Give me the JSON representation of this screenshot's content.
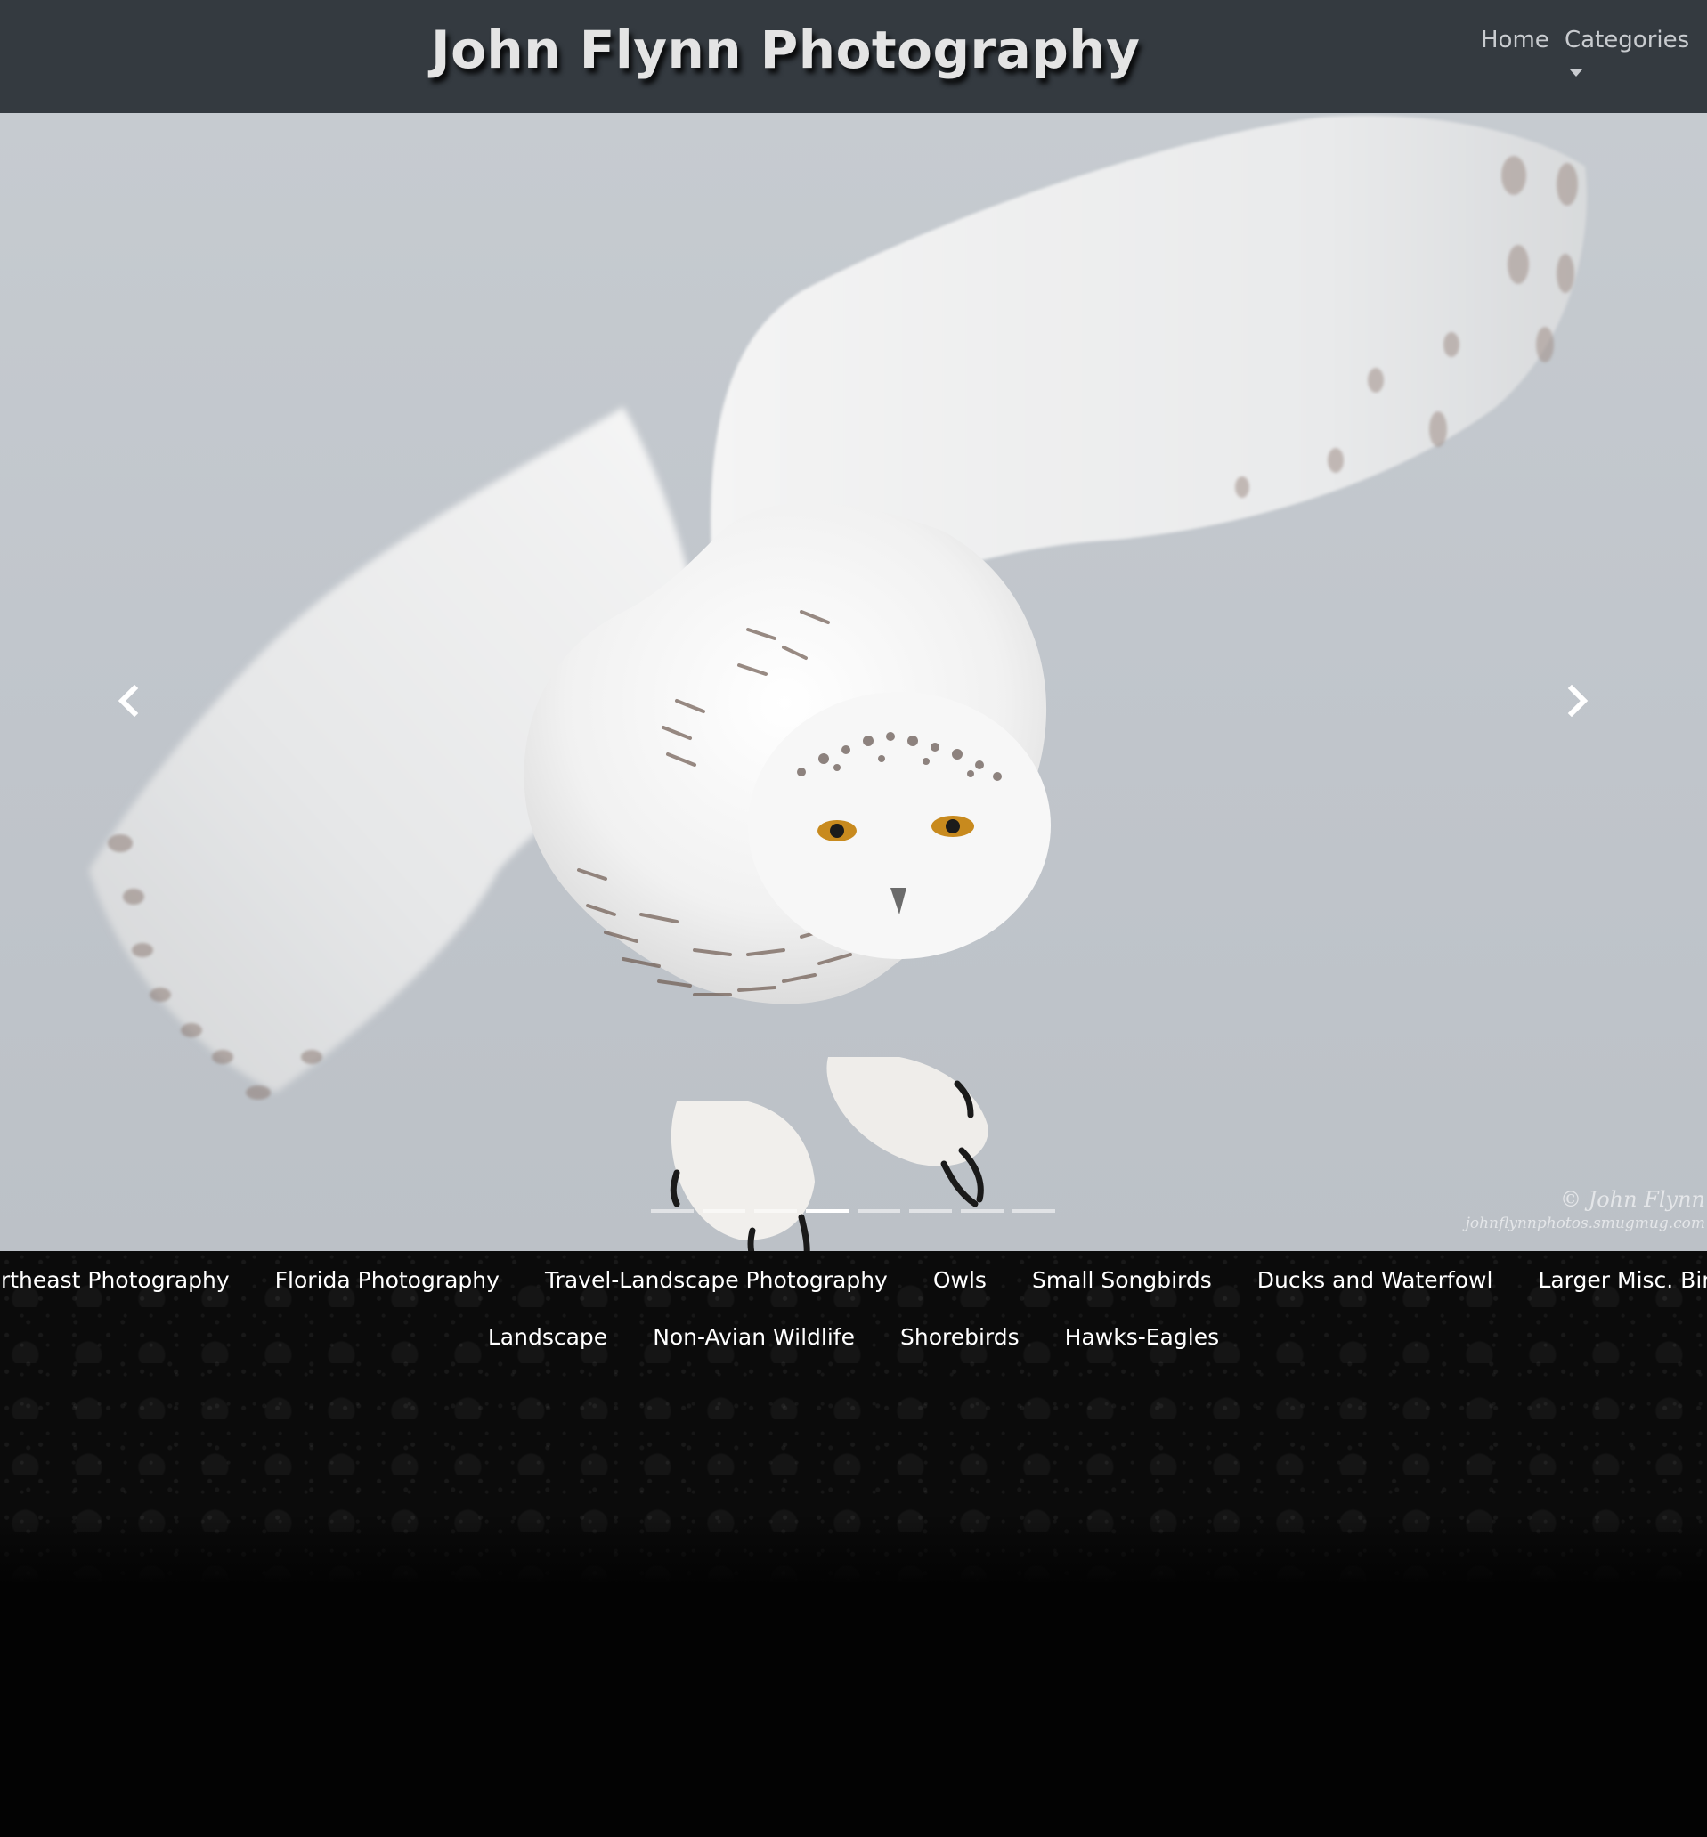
{
  "header": {
    "title": "John Flynn Photography",
    "nav": {
      "home_label": "Home",
      "categories_label": "Categories"
    }
  },
  "carousel": {
    "image_subject": "snowy owl in flight",
    "active_index": 4,
    "slide_count": 8,
    "prev_icon": "chevron-left-icon",
    "next_icon": "chevron-right-icon",
    "watermark_line1": "© John Flynn",
    "watermark_line2": "johnflynnphotos.smugmug.com"
  },
  "categories": {
    "row1": [
      "Northeast Photography",
      "Florida Photography",
      "Travel-Landscape Photography",
      "Owls",
      "Small Songbirds",
      "Ducks and Waterfowl",
      "Larger Misc. Birds"
    ],
    "row2": [
      "Landscape",
      "Non-Avian Wildlife",
      "Shorebirds",
      "Hawks-Eagles"
    ]
  },
  "colors": {
    "header_bg": "#343a40",
    "title_text": "#e4e4e4",
    "nav_text": "#c8cbcf",
    "sky": "#c1c6cc",
    "category_text": "#ffffff",
    "page_bg": "#000000"
  }
}
